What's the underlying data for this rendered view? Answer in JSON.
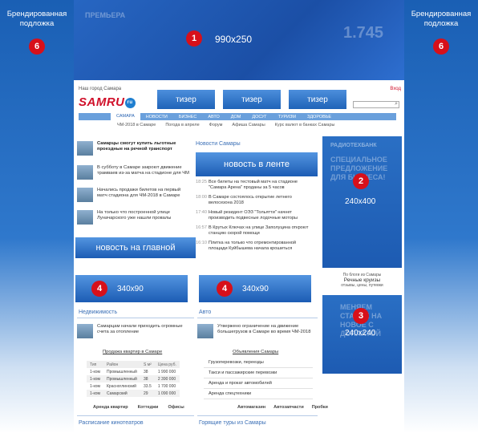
{
  "branding": {
    "left_label": "Брендированная подложка",
    "left_badge": "6",
    "right_label": "Брендированная подложка",
    "right_badge": "6"
  },
  "top_banner": {
    "badge": "1",
    "size": "990x250",
    "ghost_title": "ПРЕМЬЕРА",
    "ghost_price": "1.745"
  },
  "header": {
    "city_label": "Наш город Самара",
    "login": "Вход",
    "search_icon": "search-icon",
    "logo_text": "SAMRU",
    "logo_ru": "ru",
    "teasers": [
      "тизер",
      "тизер",
      "тизер"
    ]
  },
  "nav": {
    "items": [
      "САМАРА",
      "НОВОСТИ",
      "БИЗНЕС",
      "АВТО",
      "ДОМ",
      "ДОСУГ",
      "ТУРИЗМ",
      "ЗДОРОВЬЕ"
    ],
    "active": "САМАРА"
  },
  "subnav": [
    "ЧМ-2018 в Самаре",
    "Погода в апреле",
    "Форум",
    "Афиша Самары",
    "Курс валют в банках Самары"
  ],
  "left_news": [
    {
      "text": "Самарцы смогут купить льготные проездные на речной транспорт",
      "bold": true
    },
    {
      "text": "В субботу в Самаре закроют движение трамваев из-за матча на стадионе для ЧМ"
    },
    {
      "text": "Начались продажи билетов на первый матч стадиона для ЧМ-2018 в Самаре"
    },
    {
      "text": "На только что построенной улице Луначарского уже нашли провалы"
    }
  ],
  "banner_main": "новость на главной",
  "feed": {
    "title": "Новости Самары",
    "banner": "новость в ленте",
    "items": [
      {
        "time": "18:25",
        "text": "Все билеты на тестовый матч на стадионе \"Самара Арена\" проданы за 5 часов"
      },
      {
        "time": "18:00",
        "text": "В Самаре состоялось открытие летнего велосезона 2018"
      },
      {
        "time": "17:40",
        "text": "Новый резидент ОЭЗ \"Тольятти\" начнет производить подвесные лодочные моторы"
      },
      {
        "time": "16:57",
        "text": "В Крутых Ключах на улице Заполуцина откроют станцию скорой помощи"
      },
      {
        "time": "16:10",
        "text": "Плитка на только что отремонтированной площади Куйбышева начала крошиться"
      }
    ]
  },
  "ad2": {
    "badge": "2",
    "size": "240x400",
    "ghost_top": "РАДИОТЕХБАНК",
    "ghost_text": "СПЕЦИАЛЬНОЕ ПРЕДЛОЖЕНИЕ ДЛЯ БИЗНЕСА!"
  },
  "ad4a": {
    "badge": "4",
    "size": "340x90"
  },
  "ad4b": {
    "badge": "4",
    "size": "340x90"
  },
  "mini": {
    "line1": "По блоги из Самары",
    "line2": "Речные круизы",
    "line3": "отзывы, цены, путевки"
  },
  "ad3": {
    "badge": "3",
    "size": "240x240",
    "ghost": "МЕНЯЕМ СТАРОЕ НА НОВОЕ С ДОПЛАТОЙ"
  },
  "realty": {
    "title": "Недвижимость",
    "news": "Самарцам начали приходить огромные счета за отопление",
    "table_title": "Продажа квартир в Самаре",
    "columns": [
      "Тип",
      "Район",
      "S м²",
      "Цена руб."
    ],
    "rows": [
      [
        "1-ком",
        "Промышленный",
        "38",
        "1 990 000"
      ],
      [
        "1-ком",
        "Промышленный",
        "38",
        "2 390 000"
      ],
      [
        "1-ком",
        "Красноглинский",
        "33.5",
        "1 700 000"
      ],
      [
        "1-ком",
        "Самарский",
        "29",
        "1 090 000"
      ]
    ],
    "links": [
      "Аренда квартир",
      "Коттеджи",
      "Офисы"
    ]
  },
  "auto": {
    "title": "Авто",
    "news": "Утвержено ограничение на движение большегрузов в Самаре во время ЧМ-2018",
    "list_title": "Объявления Самары",
    "items": [
      "Грузоперевозки, переезды",
      "Такси и пассажирские перевозки",
      "Аренда и прокат автомобилей",
      "Аренда спецтехники"
    ],
    "links": [
      "Автомагазин",
      "Автозапчасти",
      "Пробки"
    ]
  },
  "bottom": {
    "left": "Расписание кинотеатров",
    "right": "Горящие туры из Самары"
  }
}
